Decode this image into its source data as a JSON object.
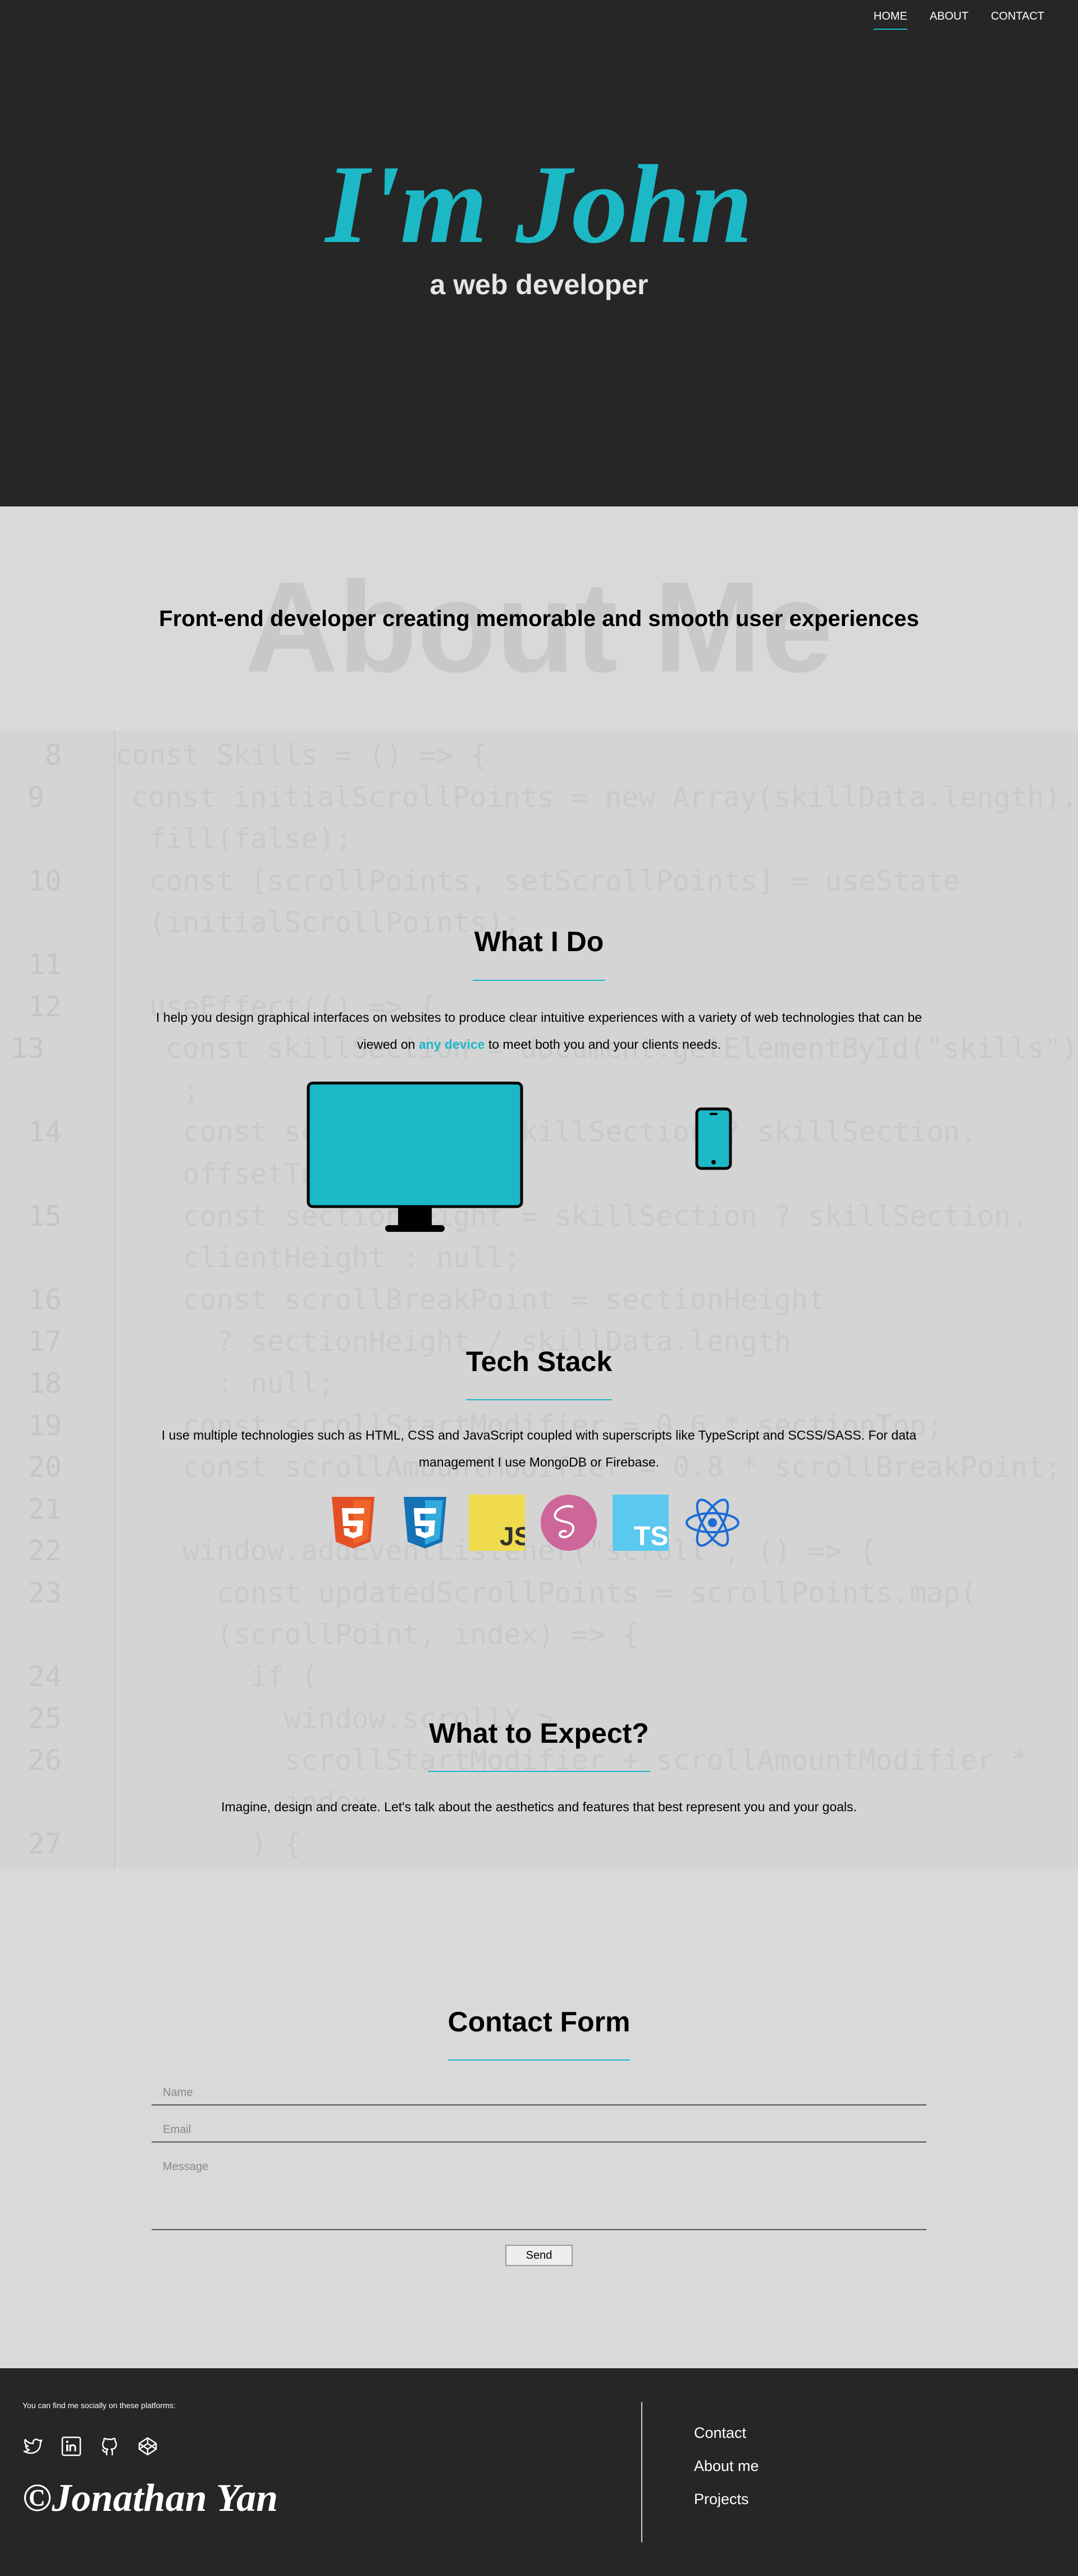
{
  "nav": {
    "items": [
      "HOME",
      "ABOUT",
      "CONTACT"
    ],
    "active": "HOME"
  },
  "hero": {
    "title": "I'm John",
    "subtitle": "a web developer"
  },
  "about": {
    "bg_title": "About Me",
    "text": "Front-end developer creating memorable and smooth user experiences"
  },
  "code_background": [
    {
      "n": "8",
      "t": "const Skills = () => {"
    },
    {
      "n": "9",
      "t": "  const initialScrollPoints = new Array(skillData.length)."
    },
    {
      "n": "",
      "t": "  fill(false);"
    },
    {
      "n": "10",
      "t": "  const [scrollPoints, setScrollPoints] = useState"
    },
    {
      "n": "",
      "t": "  (initialScrollPoints);"
    },
    {
      "n": "11",
      "t": ""
    },
    {
      "n": "12",
      "t": "  useEffect(() => {"
    },
    {
      "n": "13",
      "t": "    const skillSection = document.getElementById(\"skills\")"
    },
    {
      "n": "",
      "t": "    ;"
    },
    {
      "n": "14",
      "t": "    const sectionTop = skillSection ? skillSection."
    },
    {
      "n": "",
      "t": "    offsetTop : null;"
    },
    {
      "n": "15",
      "t": "    const sectionHeight = skillSection ? skillSection."
    },
    {
      "n": "",
      "t": "    clientHeight : null;"
    },
    {
      "n": "16",
      "t": "    const scrollBreakPoint = sectionHeight"
    },
    {
      "n": "17",
      "t": "      ? sectionHeight / skillData.length"
    },
    {
      "n": "18",
      "t": "      : null;"
    },
    {
      "n": "19",
      "t": "    const scrollStartModifier = 0.6 * sectionTop;"
    },
    {
      "n": "20",
      "t": "    const scrollAmountModifier = 0.8 * scrollBreakPoint;"
    },
    {
      "n": "21",
      "t": ""
    },
    {
      "n": "22",
      "t": "    window.addEventListener(\"scroll\", () => {"
    },
    {
      "n": "23",
      "t": "      const updatedScrollPoints = scrollPoints.map("
    },
    {
      "n": "",
      "t": "      (scrollPoint, index) => {"
    },
    {
      "n": "24",
      "t": "        if ("
    },
    {
      "n": "25",
      "t": "          window.scrollY >"
    },
    {
      "n": "26",
      "t": "          scrollStartModifier + scrollAmountModifier *"
    },
    {
      "n": "",
      "t": "          index"
    },
    {
      "n": "27",
      "t": "        ) {"
    }
  ],
  "what_i_do": {
    "title": "What I Do",
    "text_before": "I help you design graphical interfaces on websites to produce clear intuitive experiences with a variety of web technologies that can be viewed on ",
    "link": "any device",
    "text_after": " to meet both you and your clients needs."
  },
  "tech_stack": {
    "title": "Tech Stack",
    "text": "I use multiple technologies such as HTML, CSS and JavaScript coupled with superscripts like TypeScript and SCSS/SASS. For data management I use MongoDB or Firebase.",
    "icons": [
      "html5-icon",
      "css3-icon",
      "javascript-icon",
      "sass-icon",
      "typescript-icon",
      "react-icon"
    ]
  },
  "expect": {
    "title": "What to Expect?",
    "text": "Imagine, design and create. Let's talk about the aesthetics and features that best represent you and your goals."
  },
  "contact": {
    "title": "Contact Form",
    "name_placeholder": "Name",
    "email_placeholder": "Email",
    "message_placeholder": "Message",
    "send_label": "Send"
  },
  "footer": {
    "note": "You can find me socially on these platforms:",
    "social_icons": [
      "twitter-icon",
      "linkedin-icon",
      "github-icon",
      "codepen-icon"
    ],
    "name": "©Jonathan Yan",
    "links": [
      "Contact",
      "About me",
      "Projects"
    ]
  },
  "colors": {
    "accent": "#1cb8c6",
    "dark": "#262626",
    "light": "#d9d9d9"
  }
}
